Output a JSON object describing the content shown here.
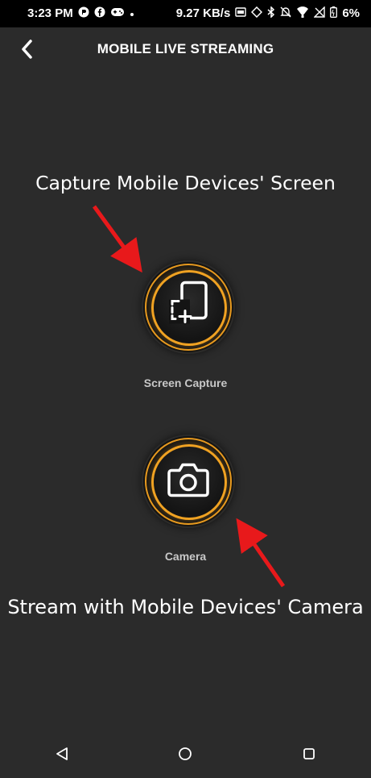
{
  "status_bar": {
    "time": "3:23 PM",
    "network_speed": "9.27 KB/s",
    "battery": "6%"
  },
  "header": {
    "title": "MOBILE LIVE STREAMING"
  },
  "annotations": {
    "top": "Capture Mobile Devices' Screen",
    "bottom": "Stream with Mobile Devices' Camera"
  },
  "options": {
    "screen_capture_label": "Screen Capture",
    "camera_label": "Camera"
  },
  "colors": {
    "background": "#2b2b2b",
    "accent_ring": "#f0a222",
    "arrow": "#e8191b"
  }
}
